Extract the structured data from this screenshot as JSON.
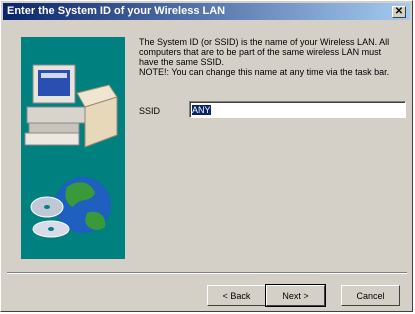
{
  "window": {
    "title": "Enter the System ID of your Wireless LAN",
    "close_glyph": "✕"
  },
  "description": {
    "line1": "The System ID (or SSID) is the name of your Wireless LAN.  All computers that are to be part of the same wireless LAN must have the same SSID.",
    "line2": "NOTE!: You can change this name at any time via the task bar."
  },
  "ssid": {
    "label": "SSID",
    "value": "ANY"
  },
  "buttons": {
    "back": "< Back",
    "next": "Next >",
    "cancel": "Cancel"
  },
  "icons": {
    "side_image": "computer-and-globe-illustration"
  },
  "colors": {
    "title_bar": "#0a246a",
    "side_panel": "#00807f",
    "selection": "#0a246a"
  }
}
